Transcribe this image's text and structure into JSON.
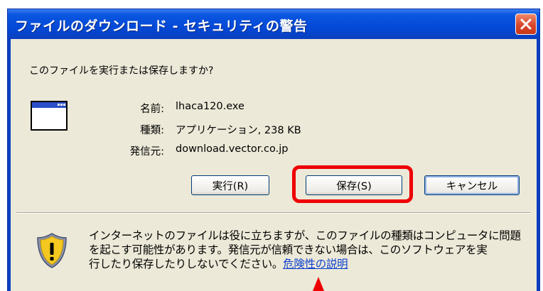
{
  "window": {
    "title": "ファイルのダウンロード - セキュリティの警告"
  },
  "question": "このファイルを実行または保存しますか?",
  "file_info": {
    "name_label": "名前:",
    "name_value": "lhaca120.exe",
    "type_label": "種類:",
    "type_value": "アプリケーション, 238 KB",
    "from_label": "発信元:",
    "from_value": "download.vector.co.jp"
  },
  "buttons": {
    "run_label": "実行(R)",
    "save_label": "保存(S)",
    "cancel_label": "キャンセル"
  },
  "warning": {
    "text": "インターネットのファイルは役に立ちますが、このファイルの種類はコンピュータに問題\nを起こす可能性があります。発信元が信頼できない場合は、このソフトウェアを実\n行したり保存したりしないでください。",
    "link_label": "危険性の説明"
  },
  "icons": {
    "close": "close-icon",
    "app": "application-window-icon",
    "warning": "warning-shield-icon"
  },
  "colors": {
    "titlebar": "#0a57e0",
    "dialog_bg": "#ece9d8",
    "highlight": "#ee0000",
    "link": "#0b3fcf"
  }
}
